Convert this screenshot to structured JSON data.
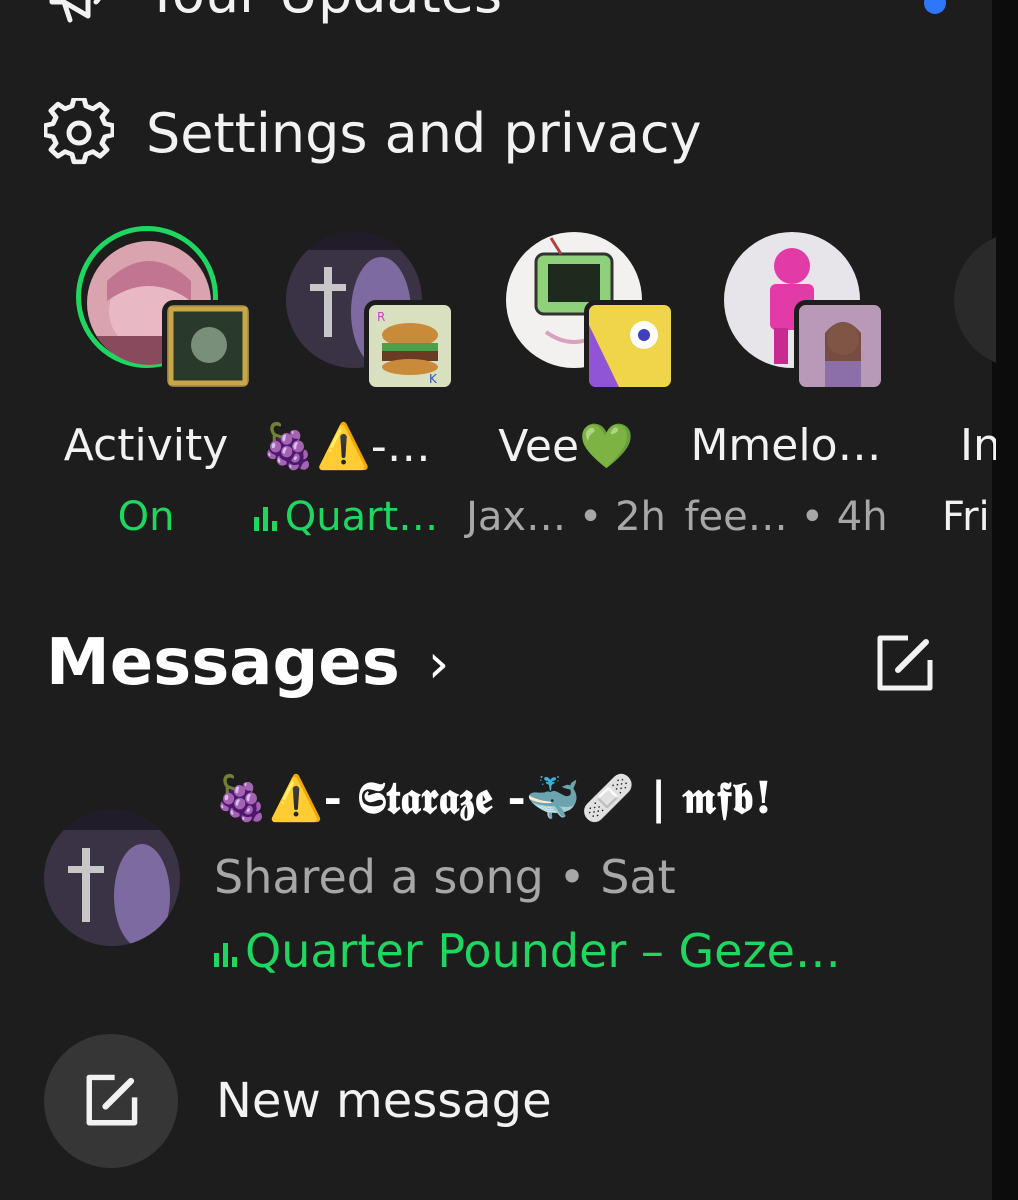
{
  "menu": {
    "updates_label": "Your Updates",
    "settings_label": "Settings and privacy",
    "updates_icon": "megaphone-icon",
    "settings_icon": "gear-icon"
  },
  "stories": [
    {
      "name": "Activity",
      "sub": "On",
      "sub_color": "#1ed760"
    },
    {
      "name": "🍇⚠️-…",
      "sub": "Quart…",
      "sub_color": "#1ed760"
    },
    {
      "name": "Vee💚",
      "sub": "Jax… • 2h",
      "sub_color": "#a7a7a7"
    },
    {
      "name": "Mmelo…",
      "sub": "fee… • 4h",
      "sub_color": "#a7a7a7"
    },
    {
      "name": "In",
      "sub": "Fri",
      "sub_color": "#a7a7a7"
    }
  ],
  "messages": {
    "heading": "Messages",
    "chevron": "›",
    "compose_icon": "compose-icon"
  },
  "conversation": {
    "name": "🍇⚠️- 𝕾𝖙𝖆𝖗𝖆𝖟𝖊 -🐳🩹 | 𝖒𝖋𝖇!",
    "line2": "Shared a song • Sat",
    "line3": "Quarter Pounder – Geze…"
  },
  "new_message": {
    "label": "New message"
  },
  "colors": {
    "background": "#1d1d1d",
    "accent_green": "#1ed760",
    "muted_text": "#a7a7a7",
    "notification_dot": "#2e77f6"
  }
}
